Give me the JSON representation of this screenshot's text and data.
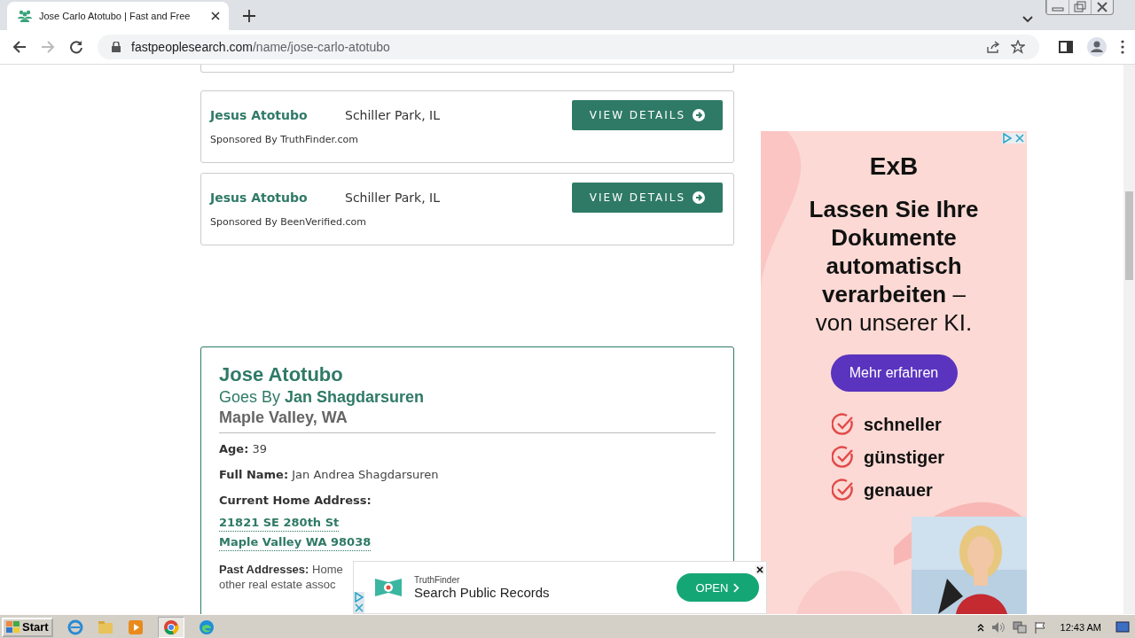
{
  "browser": {
    "tab_title": "Jose Carlo Atotubo | Fast and Free",
    "url_domain": "fastpeoplesearch.com",
    "url_path": "/name/jose-carlo-atotubo"
  },
  "sponsored": [
    {
      "name": "Jesus Atotubo",
      "location": "Schiller Park, IL",
      "button": "VIEW DETAILS",
      "sponsor": "Sponsored By TruthFinder.com"
    },
    {
      "name": "Jesus Atotubo",
      "location": "Schiller Park, IL",
      "button": "VIEW DETAILS",
      "sponsor": "Sponsored By BeenVerified.com"
    }
  ],
  "profile": {
    "name": "Jose Atotubo",
    "goes_by": "Goes By **Jan Shagdarsuren**",
    "location": "Maple Valley, WA",
    "fields": [
      {
        "kind": "text",
        "label": "Age:",
        "value": "39"
      },
      {
        "kind": "text",
        "label": "Full Name:",
        "value": "Jan Andrea Shagdarsuren"
      },
      {
        "kind": "address",
        "label": "Current Home Address:",
        "lines": [
          "21821 SE 280th St",
          "Maple Valley WA 98038"
        ]
      },
      {
        "kind": "wrapped",
        "label": "Past Addresses:",
        "value": "Home",
        "continuation": "other real estate assoc"
      }
    ]
  },
  "side_ad": {
    "brand": "ExB",
    "headline_bold": "Lassen Sie Ihre Dokumente automatisch verarbeiten",
    "headline_rest": "– von unserer KI.",
    "button": "Mehr erfahren",
    "bullets": [
      "schneller",
      "günstiger",
      "genauer"
    ]
  },
  "bottom_ad": {
    "brand": "TruthFinder",
    "title": "Search Public Records",
    "button": "OPEN"
  },
  "taskbar": {
    "start": "Start",
    "time": "12:43 AM"
  }
}
